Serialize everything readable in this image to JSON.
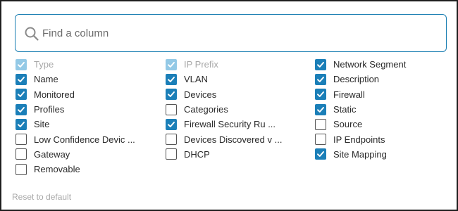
{
  "search": {
    "placeholder": "Find a column",
    "value": ""
  },
  "colors": {
    "accent": "#1b7fb8",
    "disabled_check": "#93c9e6",
    "search_border": "#1b7fb3"
  },
  "columns": [
    [
      {
        "label": "Type",
        "checked": true,
        "disabled": true
      },
      {
        "label": "Name",
        "checked": true,
        "disabled": false
      },
      {
        "label": "Monitored",
        "checked": true,
        "disabled": false
      },
      {
        "label": "Profiles",
        "checked": true,
        "disabled": false
      },
      {
        "label": "Site",
        "checked": true,
        "disabled": false
      },
      {
        "label": "Low Confidence Devic ...",
        "checked": false,
        "disabled": false
      },
      {
        "label": "Gateway",
        "checked": false,
        "disabled": false
      },
      {
        "label": "Removable",
        "checked": false,
        "disabled": false
      }
    ],
    [
      {
        "label": "IP Prefix",
        "checked": true,
        "disabled": true
      },
      {
        "label": "VLAN",
        "checked": true,
        "disabled": false
      },
      {
        "label": "Devices",
        "checked": true,
        "disabled": false
      },
      {
        "label": "Categories",
        "checked": false,
        "disabled": false
      },
      {
        "label": "Firewall Security Ru ...",
        "checked": true,
        "disabled": false
      },
      {
        "label": "Devices Discovered v ...",
        "checked": false,
        "disabled": false
      },
      {
        "label": "DHCP",
        "checked": false,
        "disabled": false
      }
    ],
    [
      {
        "label": "Network Segment",
        "checked": true,
        "disabled": false
      },
      {
        "label": "Description",
        "checked": true,
        "disabled": false
      },
      {
        "label": "Firewall",
        "checked": true,
        "disabled": false
      },
      {
        "label": "Static",
        "checked": true,
        "disabled": false
      },
      {
        "label": "Source",
        "checked": false,
        "disabled": false
      },
      {
        "label": "IP Endpoints",
        "checked": false,
        "disabled": false
      },
      {
        "label": "Site Mapping",
        "checked": true,
        "disabled": false
      }
    ]
  ],
  "footer": {
    "reset_label": "Reset to default"
  }
}
